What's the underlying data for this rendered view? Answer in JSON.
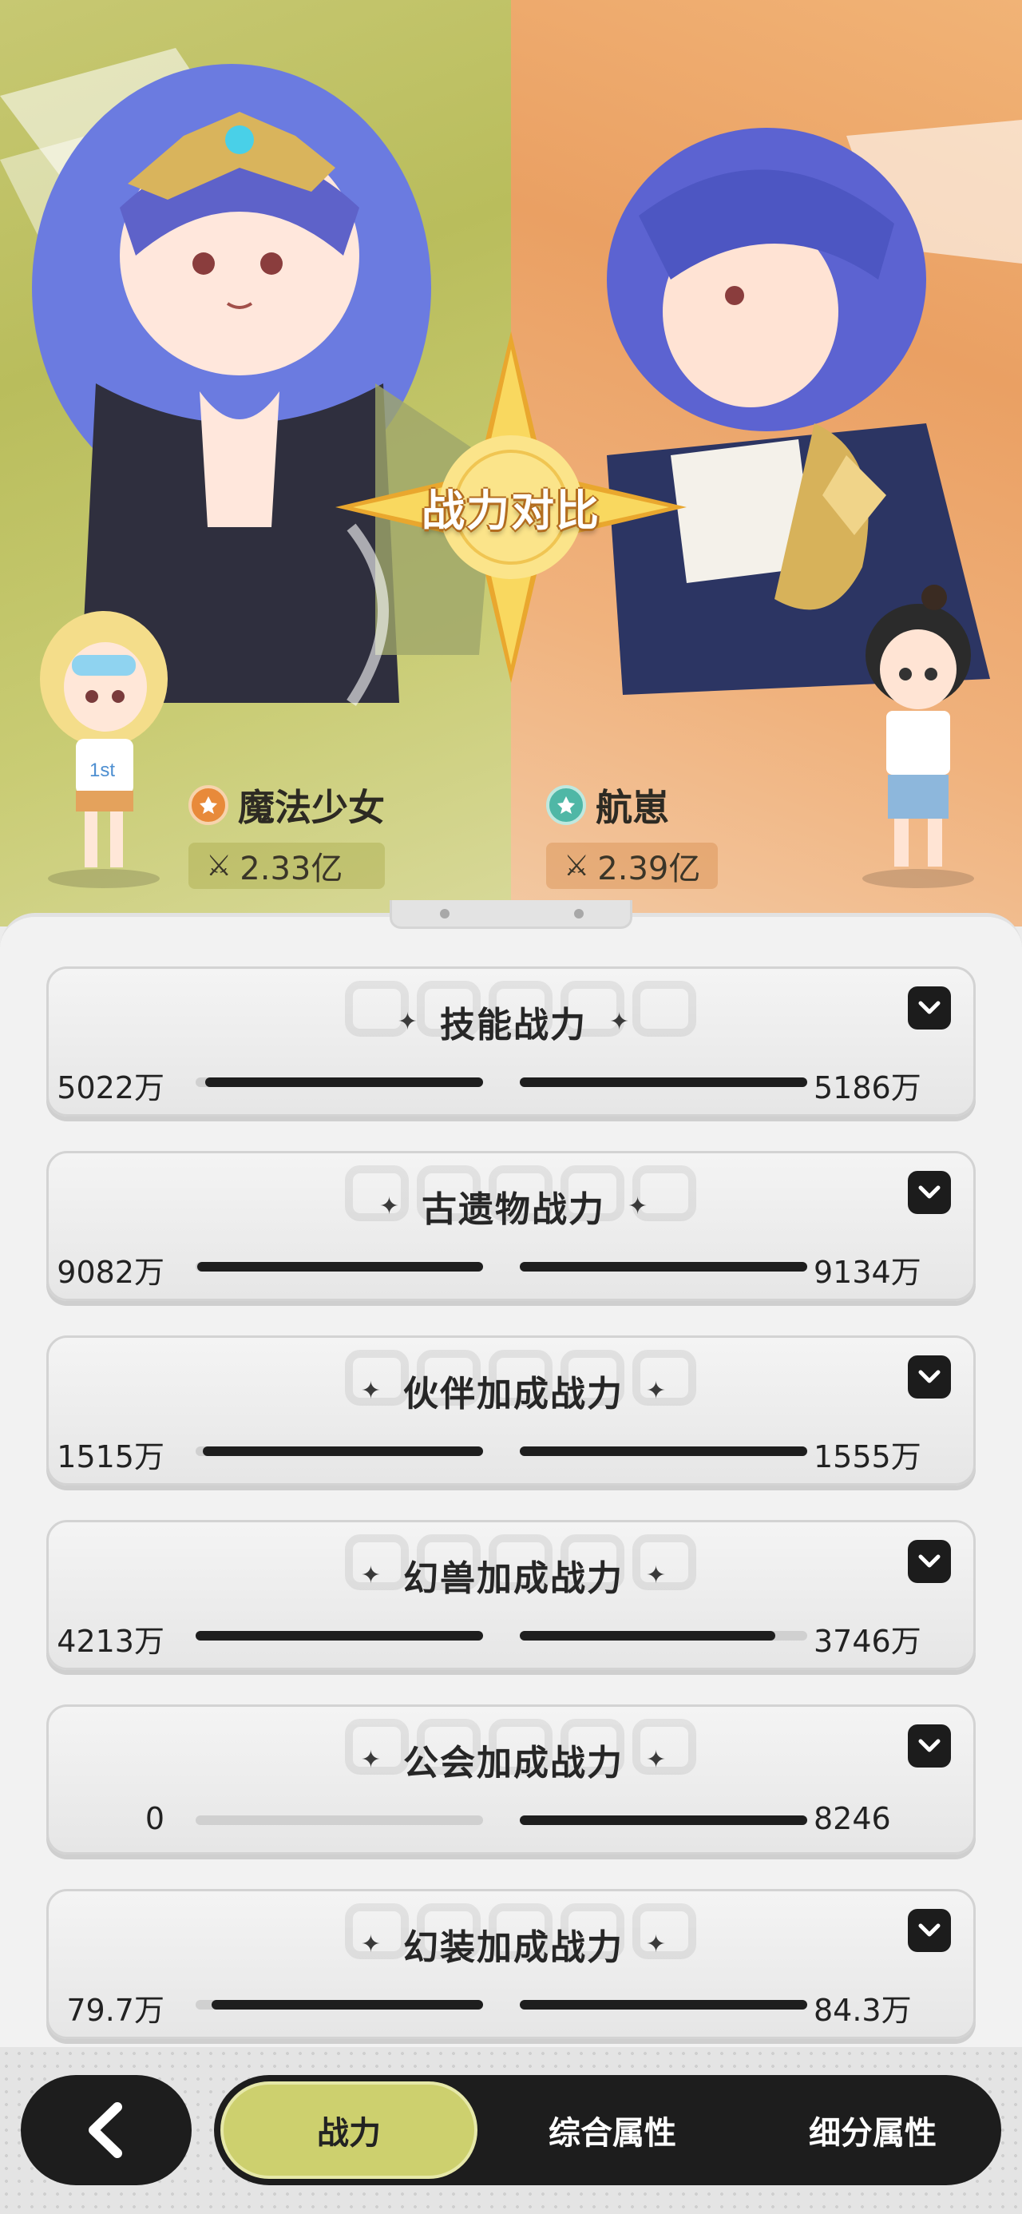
{
  "hero": {
    "title": "战力对比",
    "left_player": {
      "name": "魔法少女",
      "power": "2.33亿",
      "accent": "#e88a3a"
    },
    "right_player": {
      "name": "航崽",
      "power": "2.39亿",
      "accent": "#4fb7a6"
    },
    "colors": {
      "left_bg": "#bfc262",
      "right_bg": "#eea368",
      "star": "#f7d760"
    }
  },
  "cards": [
    {
      "title": "技能战力",
      "left_value": "5022万",
      "right_value": "5186万",
      "left_ratio": 0.968,
      "right_ratio": 1.0
    },
    {
      "title": "古遗物战力",
      "left_value": "9082万",
      "right_value": "9134万",
      "left_ratio": 0.994,
      "right_ratio": 1.0
    },
    {
      "title": "伙伴加成战力",
      "left_value": "1515万",
      "right_value": "1555万",
      "left_ratio": 0.974,
      "right_ratio": 1.0
    },
    {
      "title": "幻兽加成战力",
      "left_value": "4213万",
      "right_value": "3746万",
      "left_ratio": 1.0,
      "right_ratio": 0.889
    },
    {
      "title": "公会加成战力",
      "left_value": "0",
      "right_value": "8246",
      "left_ratio": 0.0,
      "right_ratio": 1.0
    },
    {
      "title": "幻装加成战力",
      "left_value": "79.7万",
      "right_value": "84.3万",
      "left_ratio": 0.945,
      "right_ratio": 1.0
    }
  ],
  "nav": {
    "back_icon": "chevron-left-icon",
    "tabs": [
      {
        "label": "战力",
        "active": true
      },
      {
        "label": "综合属性",
        "active": false
      },
      {
        "label": "细分属性",
        "active": false
      }
    ]
  }
}
